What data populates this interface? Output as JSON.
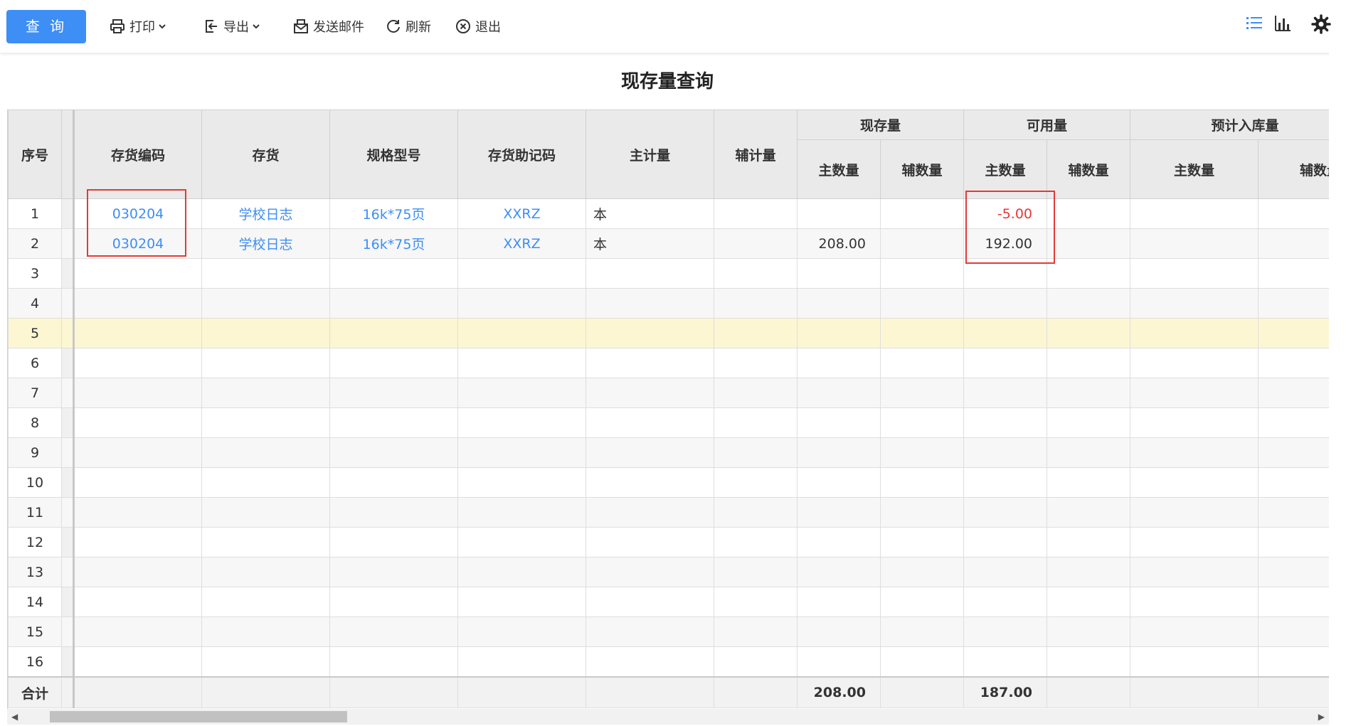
{
  "toolbar": {
    "query_label": "查 询",
    "print_label": "打印",
    "export_label": "导出",
    "email_label": "发送邮件",
    "refresh_label": "刷新",
    "exit_label": "退出"
  },
  "page_title": "现存量查询",
  "table": {
    "headers": {
      "seq": "序号",
      "code": "存货编码",
      "name": "存货",
      "spec": "规格型号",
      "mnemonic": "存货助记码",
      "main_unit": "主计量",
      "aux_unit": "辅计量",
      "onhand": "现存量",
      "available": "可用量",
      "expected_in": "预计入库量",
      "main_qty": "主数量",
      "aux_qty": "辅数量"
    },
    "rows": [
      {
        "seq": "1",
        "code": "030204",
        "name": "学校日志",
        "spec": "16k*75页",
        "mnemonic": "XXRZ",
        "main_unit": "本",
        "onhand_main": "",
        "available_main": "-5.00"
      },
      {
        "seq": "2",
        "code": "030204",
        "name": "学校日志",
        "spec": "16k*75页",
        "mnemonic": "XXRZ",
        "main_unit": "本",
        "onhand_main": "208.00",
        "available_main": "192.00"
      },
      {
        "seq": "3"
      },
      {
        "seq": "4"
      },
      {
        "seq": "5"
      },
      {
        "seq": "6"
      },
      {
        "seq": "7"
      },
      {
        "seq": "8"
      },
      {
        "seq": "9"
      },
      {
        "seq": "10"
      },
      {
        "seq": "11"
      },
      {
        "seq": "12"
      },
      {
        "seq": "13"
      },
      {
        "seq": "14"
      },
      {
        "seq": "15"
      },
      {
        "seq": "16"
      }
    ],
    "total": {
      "label": "合计",
      "onhand_main": "208.00",
      "available_main": "187.00"
    }
  },
  "colors": {
    "accent": "#3d8ef5",
    "negative": "#e53935",
    "highlight_row": "#fdf6d3",
    "annotation_box": "#e53935"
  }
}
